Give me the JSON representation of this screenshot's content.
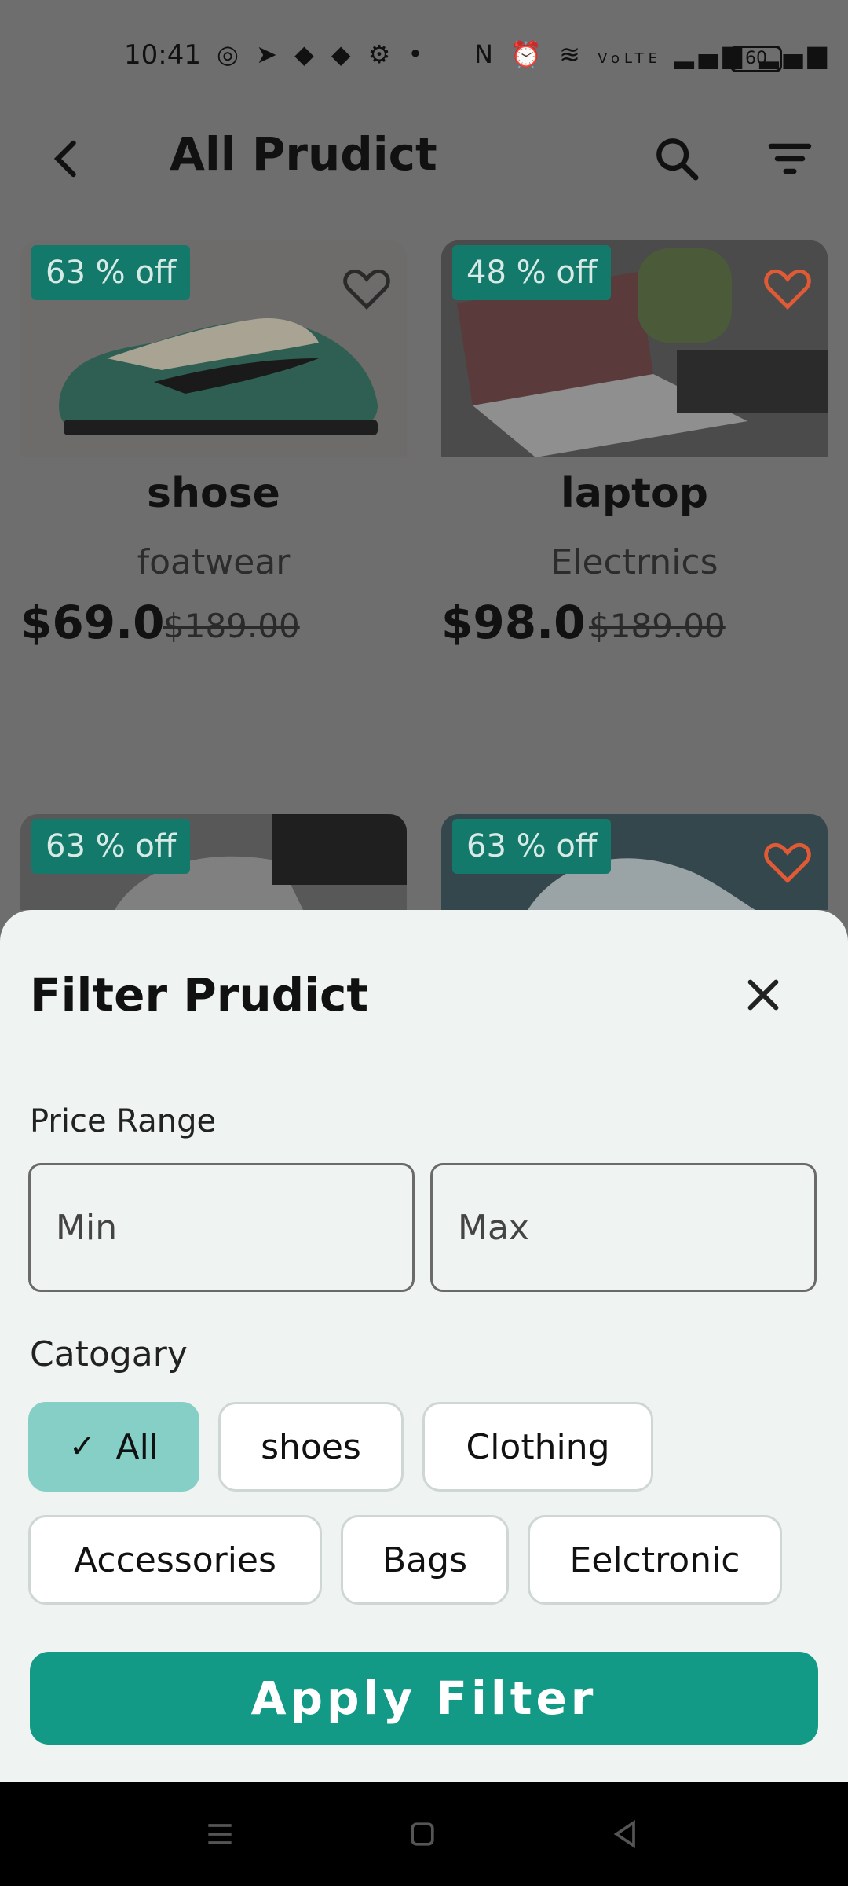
{
  "status": {
    "time": "10:41",
    "battery": "60",
    "network": "VoLTE"
  },
  "header": {
    "title": "All Prudict",
    "back_icon": "arrow-left-icon",
    "search_icon": "search-icon",
    "filter_icon": "filter-icon"
  },
  "products": [
    {
      "badge": "63 % off",
      "name": "shose",
      "category": "foatwear",
      "price": "$69.0",
      "old_price": "$189.00",
      "favorite": false
    },
    {
      "badge": "48 % off",
      "name": "laptop",
      "category": "Electrnics",
      "price": "$98.0",
      "old_price": "$189.00",
      "favorite": true
    },
    {
      "badge": "63 % off",
      "favorite": false
    },
    {
      "badge": "63 % off",
      "favorite": true
    }
  ],
  "filter": {
    "title": "Filter Prudict",
    "price_label": "Price Range",
    "min_placeholder": "Min",
    "max_placeholder": "Max",
    "category_label": "Catogary",
    "chips": [
      "All",
      "shoes",
      "Clothing",
      "Accessories",
      "Bags",
      "Eelctronic"
    ],
    "selected_chip": "All",
    "apply_label": "Apply Filter"
  },
  "colors": {
    "accent": "#139a87",
    "chip_selected": "#85cfc6",
    "badge": "#137a6b",
    "favorite": "#e05a36"
  }
}
